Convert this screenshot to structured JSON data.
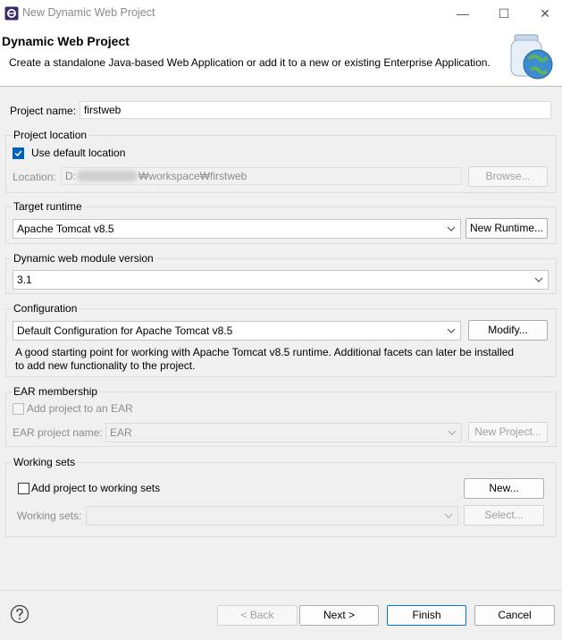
{
  "window": {
    "title": "New Dynamic Web Project",
    "controls": {
      "minimize": "—",
      "maximize": "☐",
      "close": "✕"
    }
  },
  "header": {
    "title": "Dynamic Web Project",
    "description": "Create a standalone Java-based Web Application or add it to a new or existing Enterprise Application."
  },
  "project_name": {
    "label": "Project name:",
    "value": "firstweb"
  },
  "project_location": {
    "group_title": "Project location",
    "use_default_label": "Use default location",
    "use_default_checked": true,
    "location_label": "Location:",
    "location_prefix": "D:",
    "location_suffix": "₩workspace₩firstweb",
    "browse_label": "Browse..."
  },
  "target_runtime": {
    "group_title": "Target runtime",
    "selected": "Apache Tomcat v8.5",
    "new_runtime_label": "New Runtime..."
  },
  "module_version": {
    "group_title": "Dynamic web module version",
    "selected": "3.1"
  },
  "configuration": {
    "group_title": "Configuration",
    "selected": "Default Configuration for Apache Tomcat v8.5",
    "modify_label": "Modify...",
    "description_line1": "A good starting point for working with Apache Tomcat v8.5 runtime. Additional facets can later be installed",
    "description_line2": "to add new functionality to the project."
  },
  "ear": {
    "group_title": "EAR membership",
    "add_label": "Add project to an EAR",
    "name_label": "EAR project name:",
    "name_value": "EAR",
    "new_project_label": "New Project..."
  },
  "working_sets": {
    "group_title": "Working sets",
    "add_label": "Add project to working sets",
    "new_label": "New...",
    "sets_label": "Working sets:",
    "select_label": "Select..."
  },
  "footer": {
    "back_label": "< Back",
    "next_label": "Next >",
    "finish_label": "Finish",
    "cancel_label": "Cancel"
  },
  "colors": {
    "accent": "#0078d7",
    "checkbox_checked": "#0060c0"
  }
}
